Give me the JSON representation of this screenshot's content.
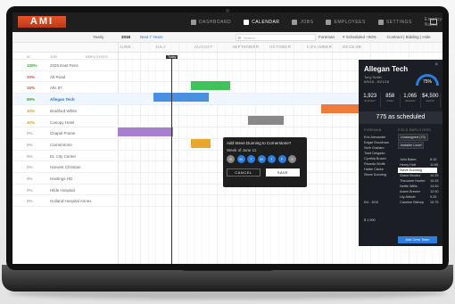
{
  "app": {
    "logo": "AMI"
  },
  "nav": [
    {
      "label": "DASHBOARD",
      "active": false
    },
    {
      "label": "CALENDAR",
      "active": true
    },
    {
      "label": "JOBS",
      "active": false
    },
    {
      "label": "EMPLOYEES",
      "active": false
    },
    {
      "label": "SETTINGS",
      "active": false
    },
    {
      "label": "Employee Name",
      "active": false
    }
  ],
  "toolbar": {
    "view": "Yearly",
    "year": "2018",
    "next": "Next 7 Years",
    "search_placeholder": "Search...",
    "foreman": "Foreman",
    "scheduled": "# Scheduled +60%",
    "contract": "Contract | Bidding | Hide"
  },
  "columns": {
    "pct": "ID",
    "job": "JOB",
    "employees": "EMPLOYEES"
  },
  "months": [
    "JUNE",
    "JULY",
    "AUGUST",
    "SEPTEMBER",
    "OCTOBER",
    "NOVEMBER",
    "DECEMB"
  ],
  "today_label": "Today",
  "jobs": [
    {
      "pct": "100%",
      "name": "2025 East Peris",
      "color": "#3aa832"
    },
    {
      "pct": "20%",
      "name": "Alt Road",
      "color": "#e84e2a"
    },
    {
      "pct": "16%",
      "name": "Alts 87",
      "color": "#e84e2a"
    },
    {
      "pct": "89%",
      "name": "Allegan Tech",
      "color": "#3aa832",
      "highlight": true
    },
    {
      "pct": "40%",
      "name": "Bradford White",
      "color": "#e0a020"
    },
    {
      "pct": "40%",
      "name": "Canopy Hotel",
      "color": "#e0a020"
    },
    {
      "pct": "0%",
      "name": "Chapel Pointe",
      "color": "#aaaaaa"
    },
    {
      "pct": "0%",
      "name": "Cornerstone",
      "color": "#aaaaaa"
    },
    {
      "pct": "0%",
      "name": "EL City Center",
      "color": "#aaaaaa"
    },
    {
      "pct": "0%",
      "name": "Harvest Christian",
      "color": "#aaaaaa"
    },
    {
      "pct": "0%",
      "name": "Hastings HD",
      "color": "#aaaaaa"
    },
    {
      "pct": "0%",
      "name": "Hilde Hospital",
      "color": "#aaaaaa"
    },
    {
      "pct": "0%",
      "name": "Holland Hospital Annex",
      "color": "#aaaaaa"
    }
  ],
  "popup": {
    "title": "Add Steve Dunning to Cornerstone?",
    "week": "Week of June 11",
    "days": [
      "S",
      "M",
      "T",
      "W",
      "T",
      "F",
      "S"
    ],
    "cancel": "CANCEL",
    "save": "SAVE"
  },
  "panel": {
    "title": "Allegan Tech",
    "sub1": "Tony Smith",
    "sub2": "6/5/18 - 8/21/18",
    "gauge": "75%",
    "stats": [
      {
        "v": "1,923",
        "l": "BUDGET"
      },
      {
        "v": "858",
        "l": "USED"
      },
      {
        "v": "1,065",
        "l": "REMAIN"
      },
      {
        "v": "$4,500",
        "l": "EQUIP"
      }
    ],
    "scheduled": "775 as scheduled",
    "foreman_tag": "FOREMAN",
    "field_tag": "FIELD EMPLOYEES",
    "unassigned": "Unassigned (70)",
    "install": "Installer Level",
    "team": [
      "Eric Alexander",
      "Edgar Goodman",
      "Seth Graham",
      "Todd Delgado",
      "Cynthia Brown",
      "Ricardo Wolfe",
      "Hattie Clarke",
      "Steve Dunning"
    ],
    "employees": [
      "Julio Baker",
      "Henry Hutt",
      "Steve Dunning",
      "Grace Brooks",
      "Theodore Hunter",
      "Nettie Willis",
      "Adam Brewer",
      "Lily Abbott",
      "Caroline Bishop"
    ],
    "hours": [
      "8:15",
      "11:55",
      "9.75",
      "10.25",
      "10.25",
      "14.00",
      "12.00",
      "9.25",
      "10.75"
    ],
    "weeks": "6/4 - 6/10",
    "cost": "$ 1,900",
    "add_button": "Add Crew Team"
  }
}
